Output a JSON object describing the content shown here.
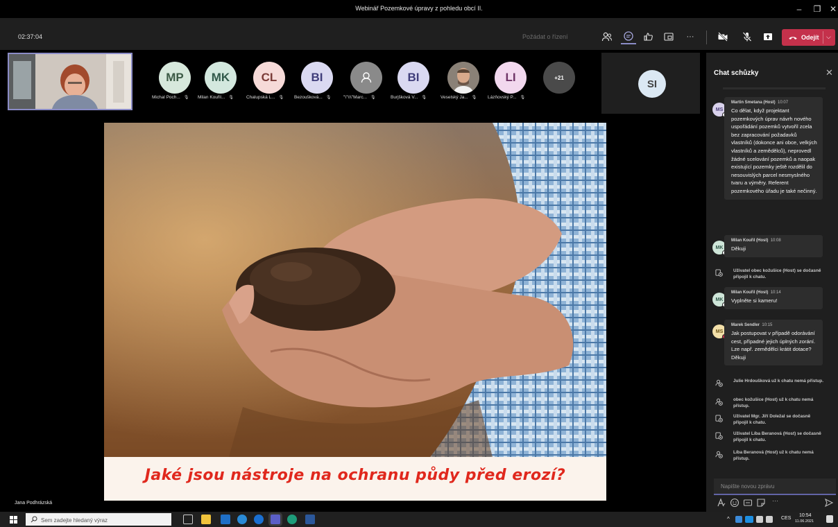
{
  "window": {
    "title": "Webinář Pozemkové úpravy z pohledu obcí II.",
    "minimize_label": "–",
    "restore_label": "❐",
    "close_label": "✕"
  },
  "meeting_bar": {
    "timer": "02:37:04",
    "request_control": "Požádat o řízení",
    "more_label": "···",
    "leave_label": "Odejít",
    "leave_chevron": "⌵"
  },
  "participants": [
    {
      "initials": "MP",
      "name": "Michal Poch...",
      "bg": "#d7e8dc",
      "fg": "#3c5a45"
    },
    {
      "initials": "MK",
      "name": "Milan Kouřil...",
      "bg": "#d3e8de",
      "fg": "#31594a"
    },
    {
      "initials": "CL",
      "name": "Chalupská L...",
      "bg": "#f6dad8",
      "fg": "#7a3b37"
    },
    {
      "initials": "BI",
      "name": "Bezoušková...",
      "bg": "#dad9f1",
      "fg": "#3f3d7a"
    },
    {
      "initials": "",
      "name": "\"\\\"\\\\\\\"Marc...",
      "bg": "#8a8a8a",
      "fg": "#ffffff"
    },
    {
      "initials": "BI",
      "name": "Burjšková V...",
      "bg": "#dad9f1",
      "fg": "#3f3d7a"
    },
    {
      "initials": "",
      "name": "Veselský Ja...",
      "bg": "#6f6760",
      "fg": "#ffffff"
    },
    {
      "initials": "LI",
      "name": "Lázňovský P...",
      "bg": "#f2d8ee",
      "fg": "#6e3466"
    }
  ],
  "overflow_count": "+21",
  "spotlight_participant": {
    "initials": "SI"
  },
  "slide": {
    "caption": "Jaké jsou nástroje na ochranu půdy před erozí?"
  },
  "presenter_name": "Jana Podhrázská",
  "chat": {
    "title": "Chat schůzky",
    "close_label": "✕",
    "messages": [
      {
        "author": "Martin Smetana (Host)",
        "time": "10:07",
        "initials": "MS",
        "text": "Co dělat, když projektant pozemkových úprav návrh nového uspořádání pozemků vytvořil zcela bez zapracování požadavků vlastníků (dokonce ani obce, velkých vlastníků a zemědělců), neprovedl žádné scelování pozemků a naopak existující pozemky ještě rozdělil do nesouvislých parcel nesmyslného tvaru a výměry. Referent pozemkového úřadu je také nečinný."
      },
      {
        "author": "Milan Kouřil (Host)",
        "time": "10:08",
        "initials": "MK",
        "text": "Děkuji"
      },
      {
        "author": "Milan Kouřil (Host)",
        "time": "10:14",
        "initials": "MK",
        "text": "Vyplněte si kameru!"
      },
      {
        "author": "Marek Sendler",
        "time": "10:15",
        "initials": "MS",
        "text": "Jak postupovat v případě odorávání cest, případné jejich úplných zorání. Lze např. zemědělci krátit dotace? Děkuji"
      }
    ],
    "system_1": "Uživatel obec kožušice (Host) se dočasně připojil k chatu.",
    "system_events": [
      "Julie Hrdoušková už k chatu nemá přístup.",
      "obec kožušice (Host) už k chatu nemá přístup.",
      "Uživatel Mgr. Jiří Doležal se dočasně připojil k chatu.",
      "Uživatel Líba Beranová (Host) se dočasně připojil k chatu.",
      "Líba Beranová (Host) už k chatu nemá přístup."
    ],
    "compose_placeholder": "Napište novou zprávu",
    "compose_more": "···"
  },
  "taskbar": {
    "search_placeholder": "Sem zadejte hledaný výraz",
    "language": "CES",
    "time": "10:54",
    "date": "11.06.2021"
  },
  "colors": {
    "accent": "#6264a7",
    "leave": "#c4314b",
    "caption": "#e0281d"
  }
}
